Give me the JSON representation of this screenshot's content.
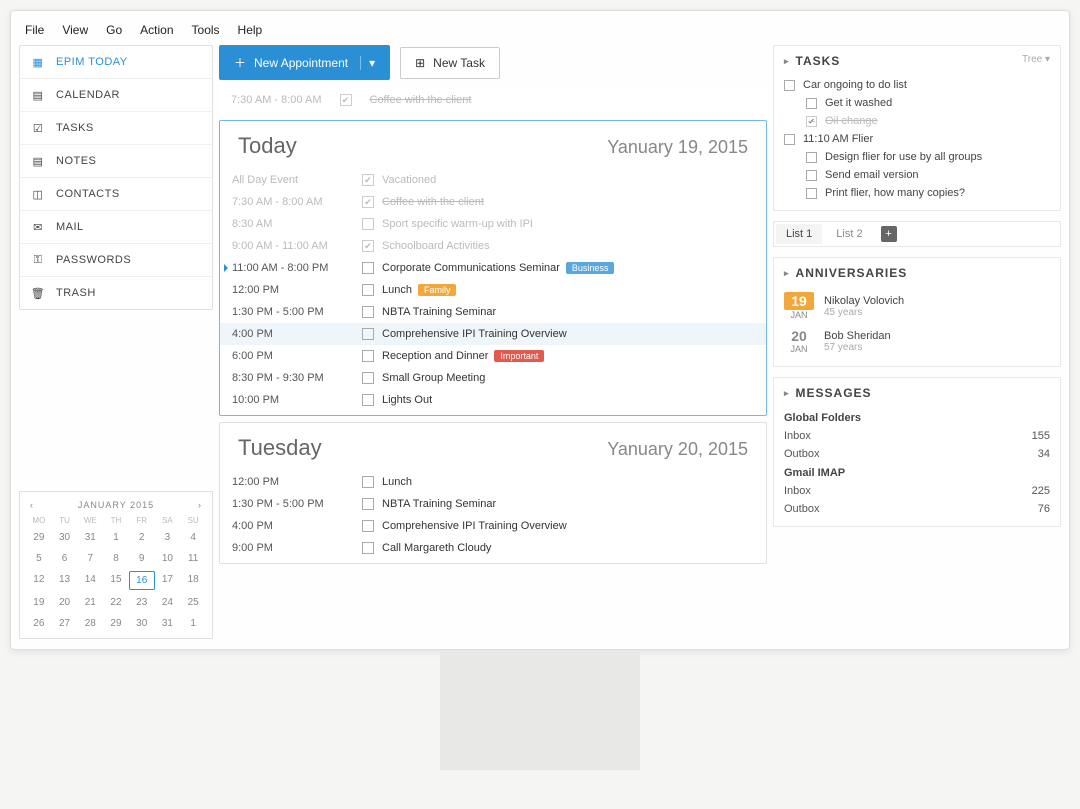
{
  "menubar": [
    "File",
    "View",
    "Go",
    "Action",
    "Tools",
    "Help"
  ],
  "sidebar": {
    "items": [
      {
        "label": "EPIM TODAY",
        "icon": "calendar-day-icon",
        "active": true
      },
      {
        "label": "CALENDAR",
        "icon": "calendar-icon"
      },
      {
        "label": "TASKS",
        "icon": "checkbox-icon"
      },
      {
        "label": "NOTES",
        "icon": "note-icon"
      },
      {
        "label": "CONTACTS",
        "icon": "contact-icon"
      },
      {
        "label": "MAIL",
        "icon": "mail-icon"
      },
      {
        "label": "PASSWORDS",
        "icon": "key-icon"
      },
      {
        "label": "TRASH",
        "icon": "trash-icon"
      }
    ]
  },
  "minical": {
    "title": "JANUARY 2015",
    "dow": [
      "MO",
      "TU",
      "WE",
      "TH",
      "FR",
      "SA",
      "SU"
    ],
    "weeks": [
      [
        "29",
        "30",
        "31",
        "1",
        "2",
        "3",
        "4"
      ],
      [
        "5",
        "6",
        "7",
        "8",
        "9",
        "10",
        "11"
      ],
      [
        "12",
        "13",
        "14",
        "15",
        "16",
        "17",
        "18"
      ],
      [
        "19",
        "20",
        "21",
        "22",
        "23",
        "24",
        "25"
      ],
      [
        "26",
        "27",
        "28",
        "29",
        "30",
        "31",
        "1"
      ]
    ],
    "selected": "16"
  },
  "toolbar": {
    "new_appt": "New Appointment",
    "new_task": "New Task"
  },
  "pinned": {
    "time": "7:30 AM - 8:00 AM",
    "label": "Coffee with the client"
  },
  "today": {
    "title": "Today",
    "date": "Yanuary 19, 2015",
    "events": [
      {
        "time": "All Day Event",
        "label": "Vacationed",
        "checked": true,
        "past": true,
        "struck": false
      },
      {
        "time": "7:30 AM - 8:00 AM",
        "label": "Coffee with the client",
        "checked": true,
        "past": true,
        "struck": true
      },
      {
        "time": "8:30 AM",
        "label": "Sport specific warm-up with IPI",
        "checked": false,
        "past": true,
        "struck": false
      },
      {
        "time": "9:00 AM - 11:00 AM",
        "label": "Schoolboard Activities",
        "checked": true,
        "past": true,
        "struck": false
      },
      {
        "time": "11:00 AM - 8:00 PM",
        "label": "Corporate Communications Seminar",
        "checked": false,
        "current": true,
        "badge": "Business",
        "badgec": "blue"
      },
      {
        "time": "12:00 PM",
        "label": "Lunch",
        "checked": false,
        "badge": "Family",
        "badgec": "orange"
      },
      {
        "time": "1:30 PM - 5:00 PM",
        "label": "NBTA Training Seminar",
        "checked": false
      },
      {
        "time": "4:00 PM",
        "label": "Comprehensive IPI Training Overview",
        "checked": false,
        "highlight": true
      },
      {
        "time": "6:00 PM",
        "label": "Reception and Dinner",
        "checked": false,
        "badge": "Important",
        "badgec": "red"
      },
      {
        "time": "8:30 PM - 9:30 PM",
        "label": "Small Group Meeting",
        "checked": false
      },
      {
        "time": "10:00 PM",
        "label": "Lights Out",
        "checked": false
      }
    ]
  },
  "tuesday": {
    "title": "Tuesday",
    "date": "Yanuary 20, 2015",
    "events": [
      {
        "time": "12:00 PM",
        "label": "Lunch",
        "checked": false
      },
      {
        "time": "1:30 PM - 5:00 PM",
        "label": "NBTA Training Seminar",
        "checked": false
      },
      {
        "time": "4:00 PM",
        "label": "Comprehensive IPI Training Overview",
        "checked": false
      },
      {
        "time": "9:00 PM",
        "label": "Call Margareth Cloudy",
        "checked": false
      }
    ]
  },
  "tasks": {
    "heading": "TASKS",
    "more": "Tree ▾",
    "items": [
      {
        "label": "Car ongoing to do list"
      },
      {
        "label": "Get it washed",
        "sub": true
      },
      {
        "label": "Oil change",
        "sub": true,
        "done": true,
        "checked": true
      },
      {
        "label": "11:10 AM Flier"
      },
      {
        "label": "Design flier for use by all groups",
        "sub": true
      },
      {
        "label": "Send email version",
        "sub": true
      },
      {
        "label": "Print flier, how many copies?",
        "sub": true
      }
    ]
  },
  "tabs": {
    "t1": "List 1",
    "t2": "List 2"
  },
  "anniversaries": {
    "heading": "ANNIVERSARIES",
    "items": [
      {
        "day": "19",
        "mon": "JAN",
        "name": "Nikolay Volovich",
        "years": "45 years",
        "gold": true
      },
      {
        "day": "20",
        "mon": "JAN",
        "name": "Bob Sheridan",
        "years": "57 years"
      }
    ]
  },
  "messages": {
    "heading": "MESSAGES",
    "groups": [
      {
        "name": "Global Folders",
        "rows": [
          {
            "name": "Inbox",
            "count": "155"
          },
          {
            "name": "Outbox",
            "count": "34"
          }
        ]
      },
      {
        "name": "Gmail IMAP",
        "rows": [
          {
            "name": "Inbox",
            "count": "225"
          },
          {
            "name": "Outbox",
            "count": "76"
          }
        ]
      }
    ]
  }
}
